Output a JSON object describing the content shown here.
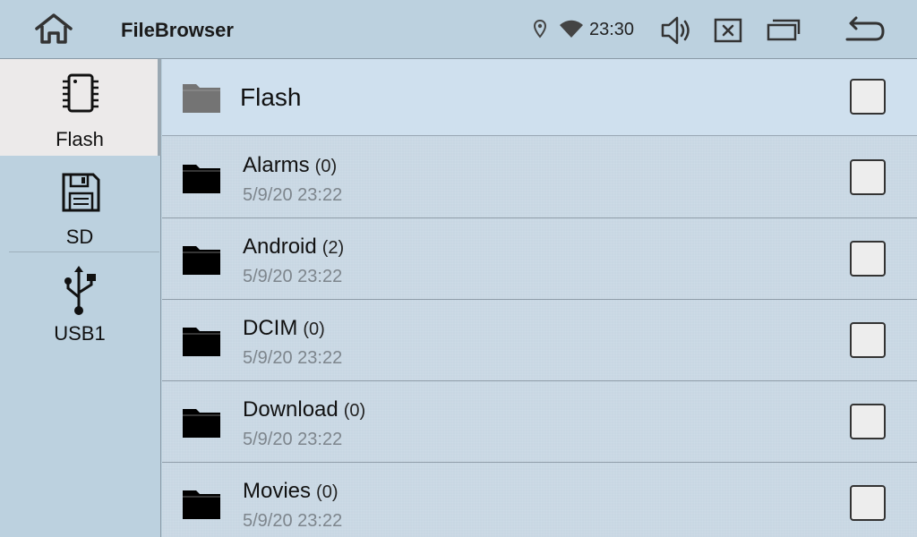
{
  "app": {
    "title": "FileBrowser"
  },
  "status": {
    "time": "23:30"
  },
  "toolbar_icons": [
    "home-icon",
    "location-icon",
    "wifi-icon",
    "volume-icon",
    "close-window-icon",
    "window-icon",
    "back-icon"
  ],
  "sidebar": {
    "items": [
      {
        "label": "Flash",
        "icon": "chip-icon",
        "active": true
      },
      {
        "label": "SD",
        "icon": "floppy-disk-icon",
        "active": false
      },
      {
        "label": "USB1",
        "icon": "usb-icon",
        "active": false
      }
    ]
  },
  "current": {
    "name": "Flash"
  },
  "files": [
    {
      "name": "Alarms",
      "count": "(0)",
      "date": "5/9/20 23:22"
    },
    {
      "name": "Android",
      "count": "(2)",
      "date": "5/9/20 23:22"
    },
    {
      "name": "DCIM",
      "count": "(0)",
      "date": "5/9/20 23:22"
    },
    {
      "name": "Download",
      "count": "(0)",
      "date": "5/9/20 23:22"
    },
    {
      "name": "Movies",
      "count": "(0)",
      "date": "5/9/20 23:22"
    }
  ],
  "colors": {
    "topbar": "#bcd1df",
    "sidebar_active": "#eceaea",
    "header_row": "#cfe0ee",
    "date_text": "#7d858c"
  }
}
